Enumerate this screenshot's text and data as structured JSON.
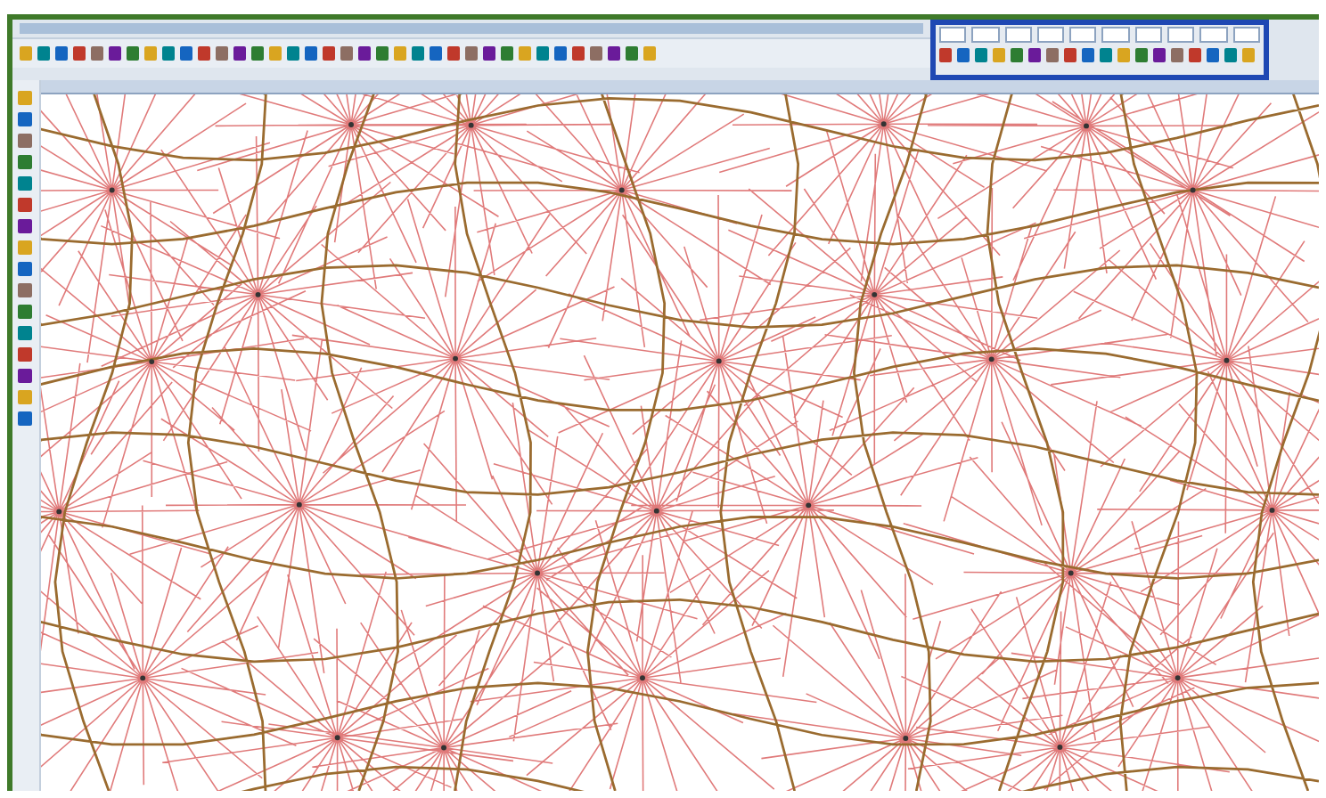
{
  "toolbars": [
    {
      "selected": false
    },
    {
      "selected": true
    }
  ]
}
